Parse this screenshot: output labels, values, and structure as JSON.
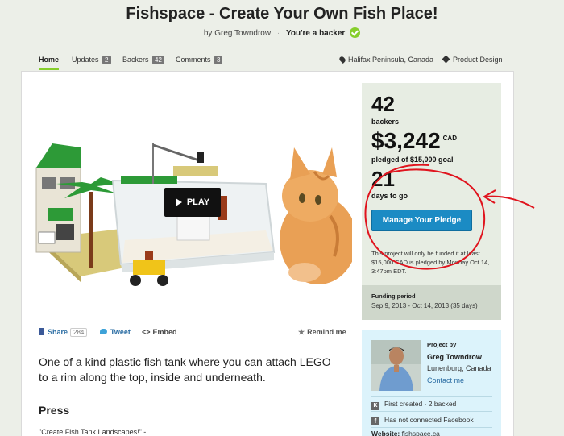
{
  "header": {
    "title": "Fishspace - Create Your Own Fish Place!",
    "byline_prefix": "by Greg Towndrow",
    "separator": "·",
    "backer_status": "You're a backer"
  },
  "nav": {
    "tabs": [
      {
        "label": "Home",
        "count": ""
      },
      {
        "label": "Updates",
        "count": "2"
      },
      {
        "label": "Backers",
        "count": "42"
      },
      {
        "label": "Comments",
        "count": "3"
      }
    ],
    "location": "Halifax Peninsula, Canada",
    "category": "Product Design"
  },
  "video": {
    "play_label": "PLAY"
  },
  "share": {
    "facebook_label": "Share",
    "facebook_count": "284",
    "tweet_label": "Tweet",
    "embed_label": "Embed",
    "remind_label": "Remind me"
  },
  "description": {
    "blurb": "One of a kind plastic fish tank where you can attach LEGO to a rim along the top, inside and underneath.",
    "press_heading": "Press",
    "press_quote": "\"Create Fish Tank Landscapes!\" -"
  },
  "stats": {
    "backers_value": "42",
    "backers_label": "backers",
    "pledged_value": "$3,242",
    "pledged_currency": "CAD",
    "pledged_label": "pledged of $15,000 goal",
    "days_value": "21",
    "days_label": "days to go",
    "pledge_button": "Manage Your Pledge",
    "funding_note": "This project will only be funded if at least $15,000 CAD is pledged by Monday Oct 14, 3:47pm EDT."
  },
  "funding_period": {
    "label": "Funding period",
    "dates": "Sep 9, 2013 - Oct 14, 2013 (35 days)"
  },
  "creator": {
    "caption": "Project by",
    "name": "Greg Towndrow",
    "location": "Lunenburg, Canada",
    "contact_label": "Contact me",
    "history": "First created · 2 backed",
    "facebook": "Has not connected Facebook",
    "website_label": "Website:",
    "website_value": "fishspace.ca"
  },
  "colors": {
    "accent_green": "#86ce2b",
    "button_blue": "#1b8bc4",
    "annotation_red": "#e0141e"
  }
}
